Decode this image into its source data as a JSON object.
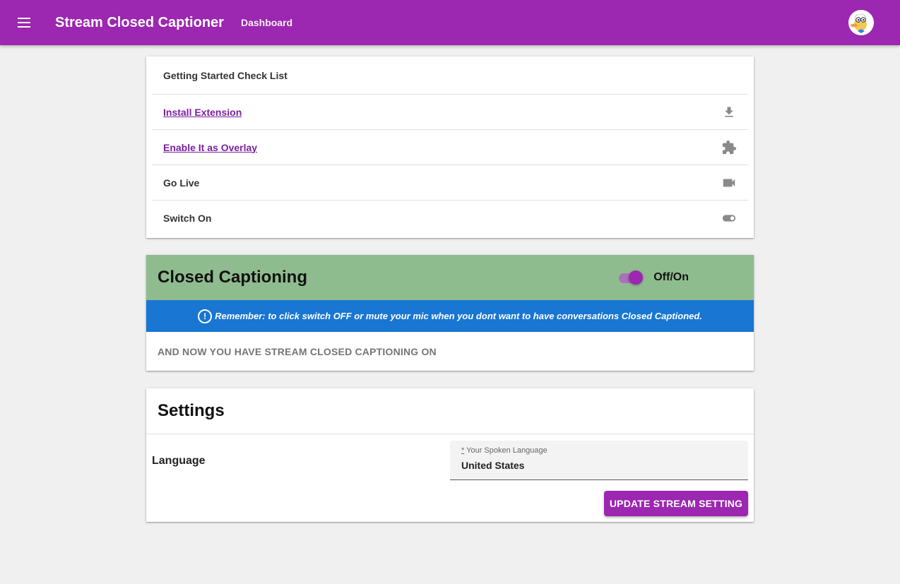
{
  "app": {
    "title": "Stream Closed Captioner",
    "nav_dashboard": "Dashboard",
    "accent_color": "#9c27b0"
  },
  "checklist": {
    "header": "Getting Started Check List",
    "items": [
      {
        "label": "Install Extension",
        "link": true,
        "icon": "download-icon"
      },
      {
        "label": "Enable It as Overlay",
        "link": true,
        "icon": "puzzle-icon"
      },
      {
        "label": "Go Live",
        "link": false,
        "icon": "video-camera-icon"
      },
      {
        "label": "Switch On",
        "link": false,
        "icon": "toggle-icon"
      }
    ]
  },
  "captioning": {
    "title": "Closed Captioning",
    "switch_label": "Off/On",
    "switch_on": true,
    "notice": "Remember: to click switch OFF or mute your mic when you dont want to have conversations Closed Captioned.",
    "status": "AND NOW YOU HAVE STREAM CLOSED CAPTIONING ON",
    "header_color": "#8fbc8f",
    "notice_color": "#1976d2"
  },
  "settings": {
    "title": "Settings",
    "language_label": "Language",
    "field_required_mark": "*",
    "field_label": "Your Spoken Language",
    "field_value": "United States",
    "update_button": "UPDATE STREAM SETTING"
  }
}
